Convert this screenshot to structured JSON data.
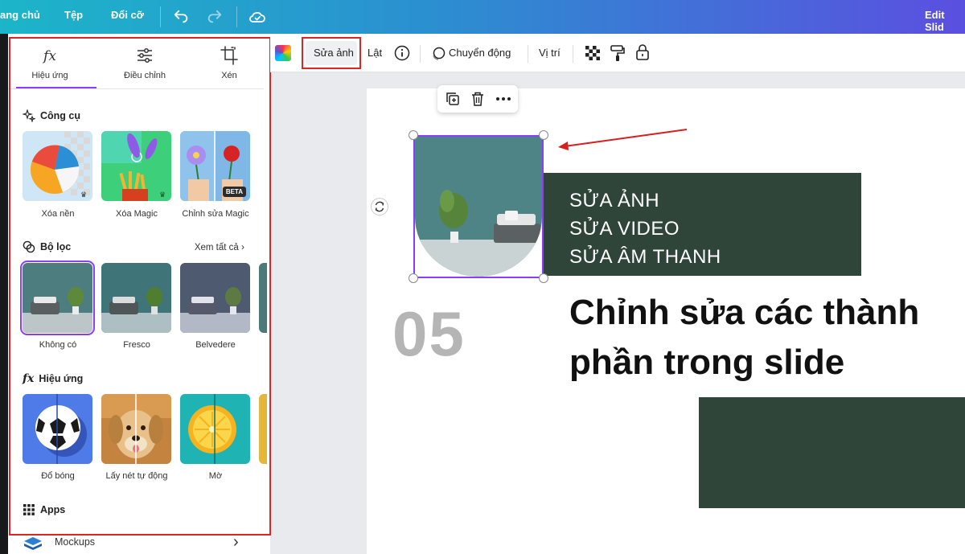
{
  "topbar": {
    "home": "ang chủ",
    "file": "Tệp",
    "resize": "Đổi cỡ",
    "right_title": "Edit Slid"
  },
  "panel": {
    "tabs": [
      {
        "label": "Hiệu ứng",
        "icon": "fx-icon"
      },
      {
        "label": "Điều chỉnh",
        "icon": "sliders-icon"
      },
      {
        "label": "Xén",
        "icon": "crop-icon"
      }
    ],
    "tools": {
      "title": "Công cụ",
      "items": [
        {
          "label": "Xóa nền"
        },
        {
          "label": "Xóa Magic"
        },
        {
          "label": "Chỉnh sửa Magic",
          "badge": "BETA"
        }
      ]
    },
    "filters": {
      "title": "Bộ lọc",
      "see_all": "Xem tất cả",
      "items": [
        {
          "label": "Không có"
        },
        {
          "label": "Fresco"
        },
        {
          "label": "Belvedere"
        }
      ]
    },
    "effects": {
      "title": "Hiệu ứng",
      "items": [
        {
          "label": "Đổ bóng"
        },
        {
          "label": "Lấy nét tự động"
        },
        {
          "label": "Mờ"
        }
      ]
    },
    "apps": {
      "title": "Apps",
      "first": "Mockups"
    }
  },
  "toolbar": {
    "edit_photo": "Sửa ảnh",
    "flip": "Lật",
    "animate": "Chuyển động",
    "position": "Vị trí"
  },
  "slide": {
    "box_lines": [
      "SỬA ẢNH",
      "SỬA VIDEO",
      "SỬA ÂM THANH"
    ],
    "number": "05",
    "heading_line1": "Chỉnh sửa các thành",
    "heading_line2": "phần trong slide"
  },
  "colors": {
    "accent": "#8b3dff",
    "highlight_red": "#e02424",
    "dark_green": "#2f4539"
  }
}
